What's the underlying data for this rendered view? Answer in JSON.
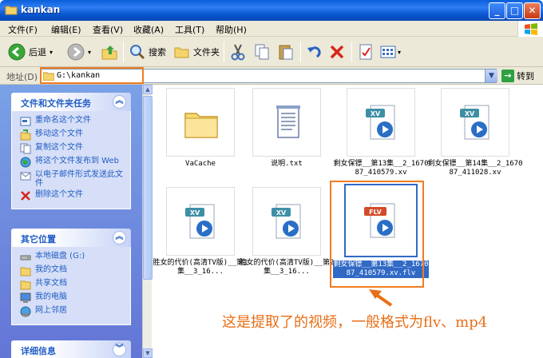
{
  "window": {
    "title": "kankan"
  },
  "menu": [
    "文件(F)",
    "编辑(E)",
    "查看(V)",
    "收藏(A)",
    "工具(T)",
    "帮助(H)"
  ],
  "toolbar": {
    "back": "后退",
    "search": "搜索",
    "folders": "文件夹"
  },
  "address": {
    "label": "地址(D)",
    "value": "G:\\kankan",
    "go": "转到"
  },
  "tasks_panel": {
    "title": "文件和文件夹任务",
    "items": [
      "重命名这个文件",
      "移动这个文件",
      "复制这个文件",
      "将这个文件发布到 Web",
      "以电子邮件形式发送此文件",
      "删除这个文件"
    ]
  },
  "places_panel": {
    "title": "其它位置",
    "items": [
      "本地磁盘 (G:)",
      "我的文档",
      "共享文档",
      "我的电脑",
      "网上邻居"
    ]
  },
  "details_panel": {
    "title": "详细信息"
  },
  "files": [
    {
      "name": "VaCache",
      "type": "folder"
    },
    {
      "name": "说明.txt",
      "type": "text"
    },
    {
      "name": "剩女保镖__第13集__2_167087_410579.xv",
      "type": "xv",
      "badge": "XV"
    },
    {
      "name": "剩女保镖__第14集__2_167087_411028.xv",
      "type": "xv",
      "badge": "XV"
    },
    {
      "name": "胜女的代价(高清TV版)__第1集__3_16...",
      "type": "xv",
      "badge": "XV"
    },
    {
      "name": "胜女的代价(高清TV版)__第2集__3_16...",
      "type": "xv",
      "badge": "XV"
    },
    {
      "name": "剩女保镖__第13集__2_167087_410579.xv.flv",
      "type": "flv",
      "badge": "FLV",
      "selected": true
    }
  ],
  "annotation": "这是提取了的视频，一般格式为flv、mp4",
  "colors": {
    "titlebar": "#0a5fd8",
    "task_text": "#215dc6",
    "selection": "#316ac5",
    "annotation": "#e86f17"
  }
}
